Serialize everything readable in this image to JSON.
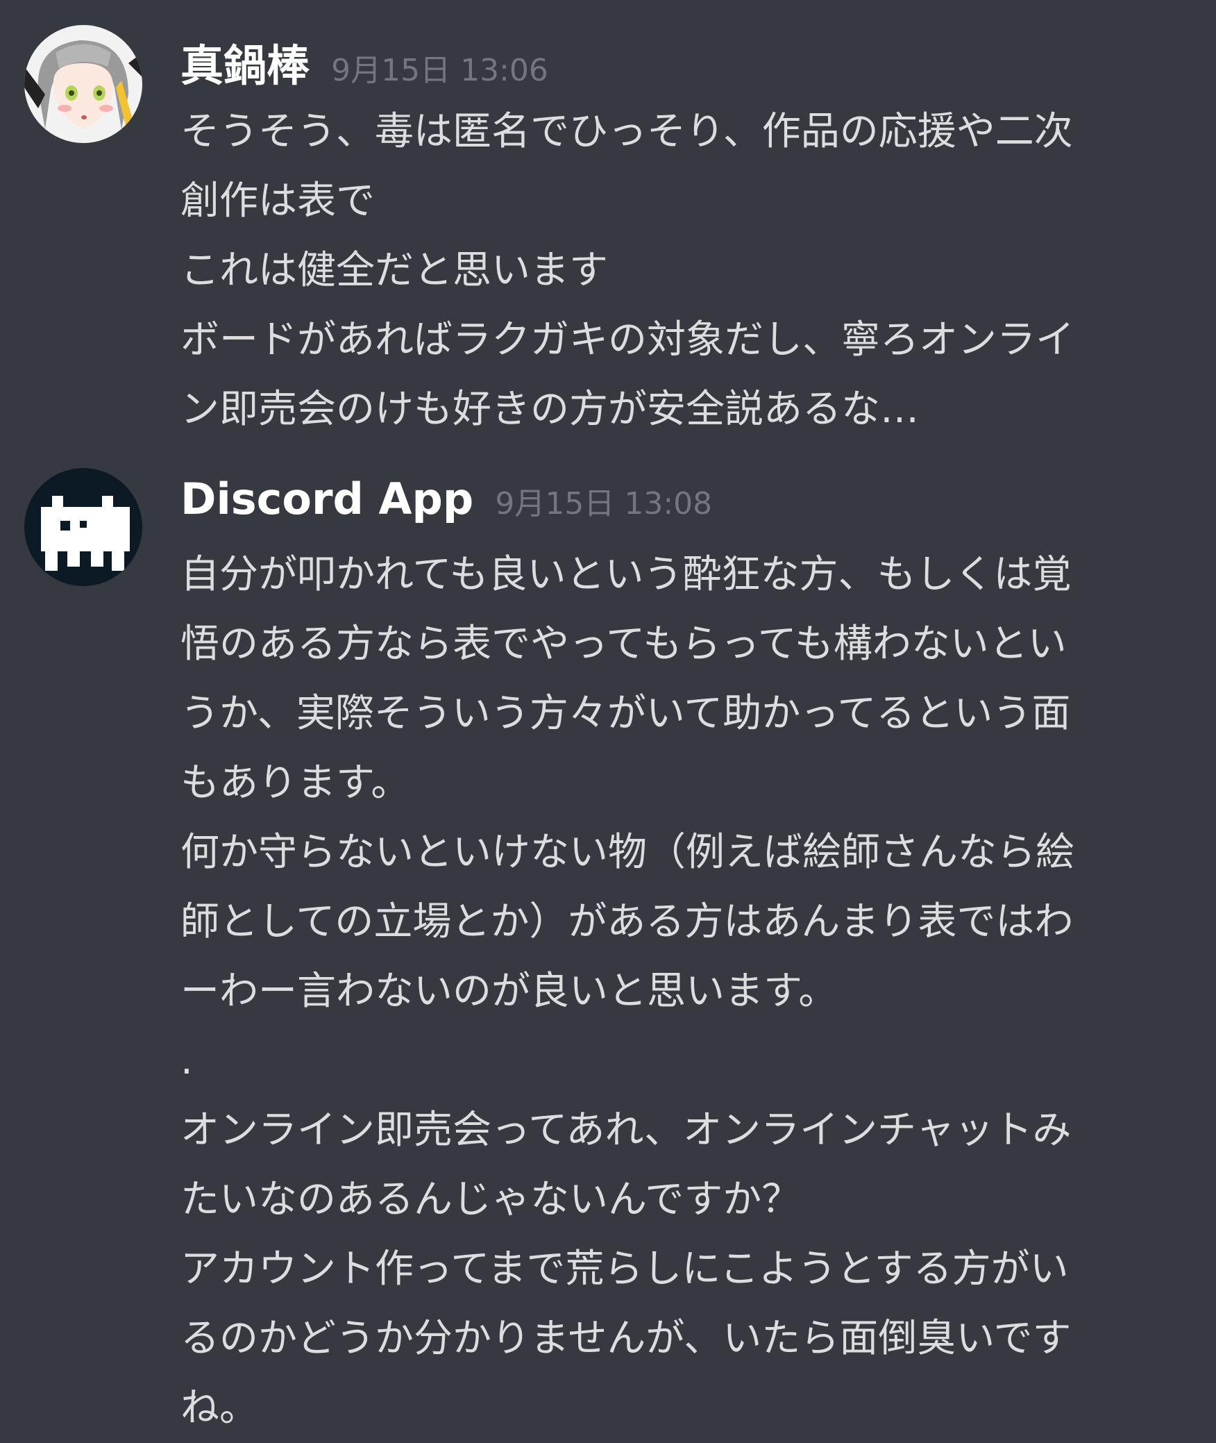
{
  "messages": [
    {
      "author": "真鍋棒",
      "timestamp": "9月15日 13:06",
      "avatar_icon": "anime-character-avatar-icon",
      "lines": [
        "そうそう、毒は匿名でひっそり、作品の応援や二次",
        "創作は表で",
        "これは健全だと思います",
        "ボードがあればラクガキの対象だし、寧ろオンライ",
        "ン即売会のけも好きの方が安全説あるな…"
      ]
    },
    {
      "author": "Discord App",
      "timestamp": "9月15日 13:08",
      "avatar_icon": "pixel-cat-avatar-icon",
      "lines": [
        "自分が叩かれても良いという酔狂な方、もしくは覚",
        "悟のある方なら表でやってもらっても構わないとい",
        "うか、実際そういう方々がいて助かってるという面",
        "もあります。",
        "何か守らないといけない物（例えば絵師さんなら絵",
        "師としての立場とか）がある方はあんまり表ではわ",
        "ーわー言わないのが良いと思います。",
        ".",
        "オンライン即売会ってあれ、オンラインチャットみ",
        "たいなのあるんじゃないんですか？",
        "アカウント作ってまで荒らしにこようとする方がい",
        "るのかどうか分かりませんが、いたら面倒臭いです",
        "ね。"
      ]
    }
  ],
  "colors": {
    "background": "#36393f",
    "username": "#ffffff",
    "timestamp": "#72767d",
    "text": "#dcddde"
  }
}
